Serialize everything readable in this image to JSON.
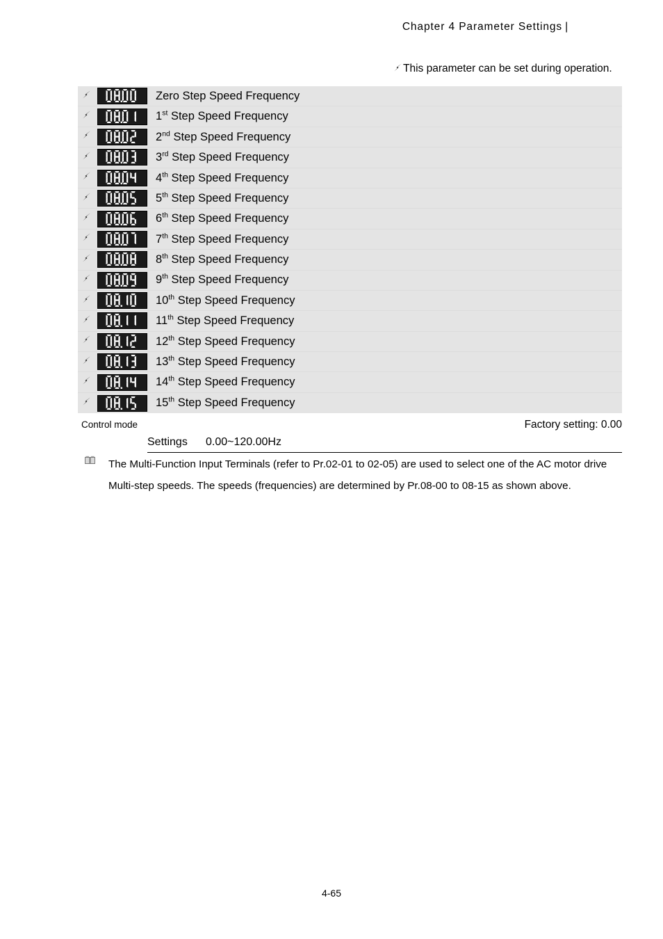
{
  "header": {
    "title": "Chapter  4  Parameter  Settings",
    "bar": "|"
  },
  "operation_note": {
    "icon": "pencil-icon",
    "text": "This parameter can be set during operation."
  },
  "table": {
    "background_color": "#e4e4e4",
    "row_icon": "pencil-icon",
    "rows": [
      {
        "code": "08.00",
        "label": "Zero Step Speed Frequency",
        "ordinal": "",
        "suffix": ""
      },
      {
        "code": "08.01",
        "label": "1",
        "ordinal": "st",
        "suffix": " Step Speed Frequency"
      },
      {
        "code": "08.02",
        "label": "2",
        "ordinal": "nd",
        "suffix": " Step Speed Frequency"
      },
      {
        "code": "08.03",
        "label": "3",
        "ordinal": "rd",
        "suffix": " Step Speed Frequency"
      },
      {
        "code": "08.04",
        "label": "4",
        "ordinal": "th",
        "suffix": " Step Speed Frequency"
      },
      {
        "code": "08.05",
        "label": "5",
        "ordinal": "th",
        "suffix": " Step Speed Frequency"
      },
      {
        "code": "08.06",
        "label": "6",
        "ordinal": "th",
        "suffix": " Step Speed Frequency"
      },
      {
        "code": "08.07",
        "label": "7",
        "ordinal": "th",
        "suffix": " Step Speed Frequency"
      },
      {
        "code": "08.08",
        "label": "8",
        "ordinal": "th",
        "suffix": " Step Speed Frequency"
      },
      {
        "code": "08.09",
        "label": "9",
        "ordinal": "th",
        "suffix": " Step Speed Frequency"
      },
      {
        "code": "08.10",
        "label": "10",
        "ordinal": "th",
        "suffix": " Step Speed Frequency"
      },
      {
        "code": "08.11",
        "label": "11",
        "ordinal": "th",
        "suffix": " Step Speed Frequency"
      },
      {
        "code": "08.12",
        "label": "12",
        "ordinal": "th",
        "suffix": " Step Speed Frequency"
      },
      {
        "code": "08.13",
        "label": "13",
        "ordinal": "th",
        "suffix": " Step Speed Frequency"
      },
      {
        "code": "08.14",
        "label": "14",
        "ordinal": "th",
        "suffix": " Step Speed Frequency"
      },
      {
        "code": "08.15",
        "label": "15",
        "ordinal": "th",
        "suffix": " Step Speed Frequency"
      }
    ]
  },
  "control_mode": {
    "label": "Control mode"
  },
  "factory": {
    "text": "Factory setting: 0.00"
  },
  "settings": {
    "label": "Settings",
    "value": "0.00~120.00Hz"
  },
  "body_note": {
    "icon": "book-icon",
    "text": "The Multi-Function Input Terminals (refer to Pr.02-01 to 02-05) are used to select one of the AC motor drive Multi-step speeds. The speeds (frequencies) are determined by Pr.08-00 to 08-15 as shown above."
  },
  "footer": {
    "page_number": "4-65"
  }
}
